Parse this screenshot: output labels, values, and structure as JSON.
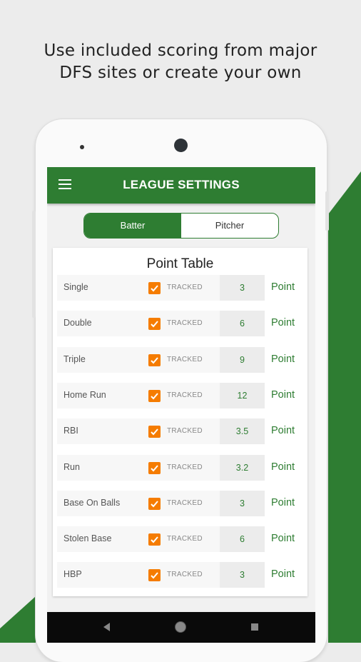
{
  "headline": {
    "line1": "Use included scoring from major",
    "line2": "DFS sites or create your own"
  },
  "colors": {
    "brand_green": "#2e7d32",
    "checkbox_orange": "#f57c00"
  },
  "appbar": {
    "title": "LEAGUE SETTINGS",
    "menu_icon": "hamburger-menu-icon"
  },
  "segment": {
    "tabs": [
      {
        "label": "Batter",
        "selected": true
      },
      {
        "label": "Pitcher",
        "selected": false
      }
    ]
  },
  "point_table": {
    "title": "Point Table",
    "rows": [
      {
        "label": "Single",
        "status": "TRACKED",
        "value": "3",
        "unit": "Point"
      },
      {
        "label": "Double",
        "status": "TRACKED",
        "value": "6",
        "unit": "Point"
      },
      {
        "label": "Triple",
        "status": "TRACKED",
        "value": "9",
        "unit": "Point"
      },
      {
        "label": "Home Run",
        "status": "TRACKED",
        "value": "12",
        "unit": "Point"
      },
      {
        "label": "RBI",
        "status": "TRACKED",
        "value": "3.5",
        "unit": "Point"
      },
      {
        "label": "Run",
        "status": "TRACKED",
        "value": "3.2",
        "unit": "Point"
      },
      {
        "label": "Base On Balls",
        "status": "TRACKED",
        "value": "3",
        "unit": "Point"
      },
      {
        "label": "Stolen Base",
        "status": "TRACKED",
        "value": "6",
        "unit": "Point"
      },
      {
        "label": "HBP",
        "status": "TRACKED",
        "value": "3",
        "unit": "Point"
      }
    ]
  },
  "navbar": {
    "back_icon": "back-triangle-icon",
    "home_icon": "home-circle-icon",
    "recent_icon": "recents-square-icon"
  }
}
